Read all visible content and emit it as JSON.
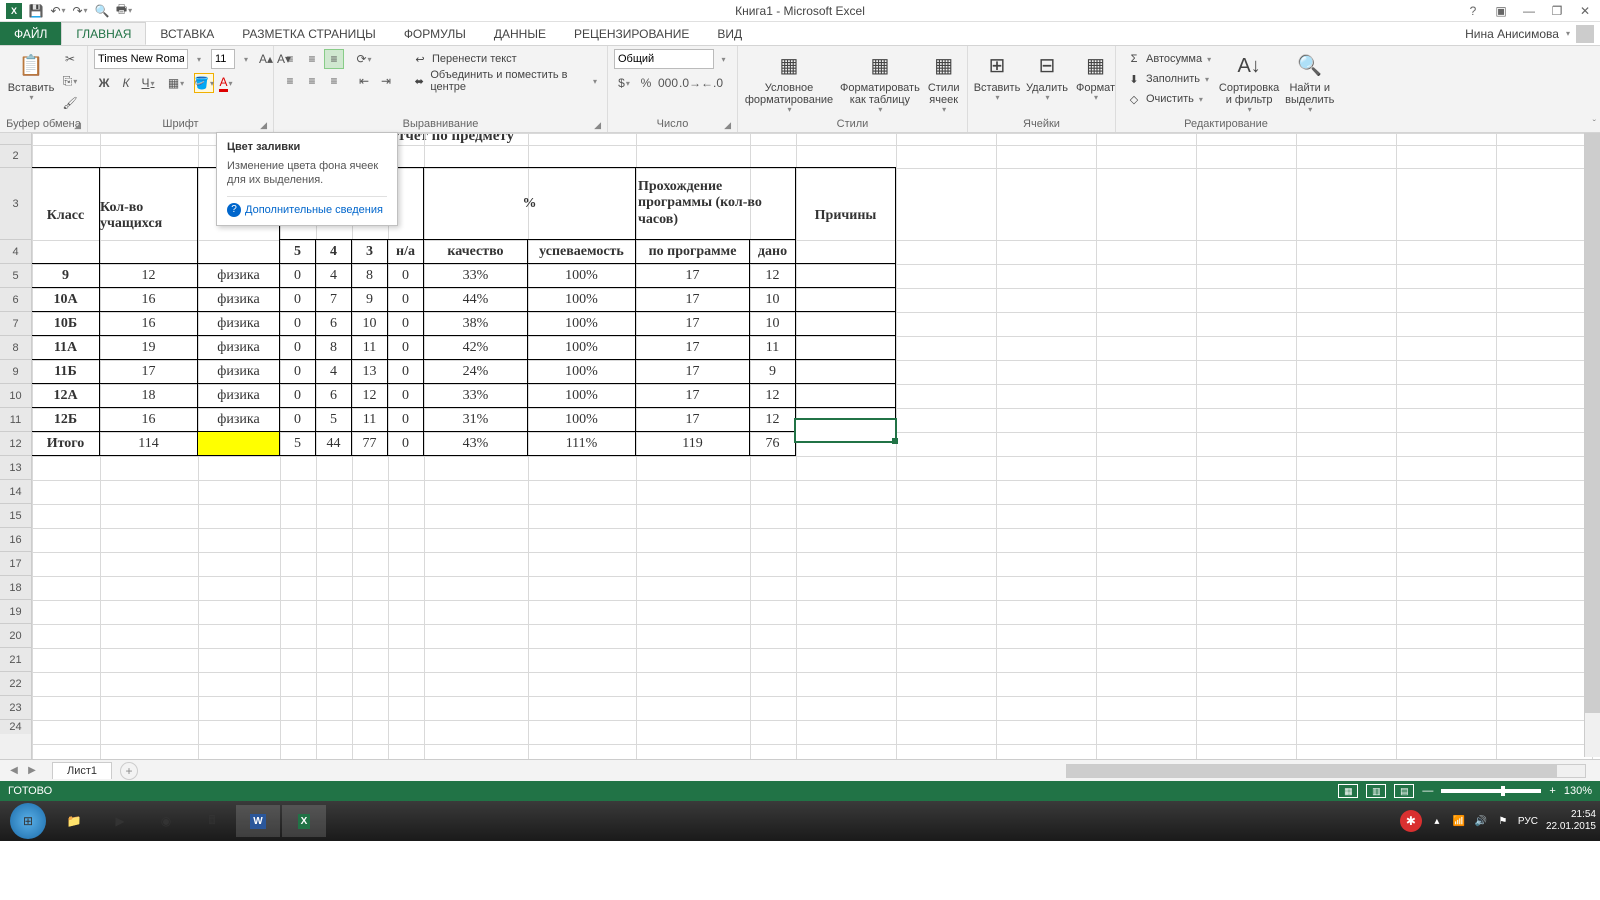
{
  "title": "Книга1 - Microsoft Excel",
  "user": "Нина Анисимова",
  "tabs": {
    "file": "ФАЙЛ",
    "home": "ГЛАВНАЯ",
    "insert": "ВСТАВКА",
    "layout": "РАЗМЕТКА СТРАНИЦЫ",
    "formulas": "ФОРМУЛЫ",
    "data": "ДАННЫЕ",
    "review": "РЕЦЕНЗИРОВАНИЕ",
    "view": "ВИД"
  },
  "ribbon": {
    "clipboard": {
      "paste": "Вставить",
      "label": "Буфер обмена"
    },
    "font": {
      "name": "Times New Roma",
      "size": "11",
      "bold": "Ж",
      "italic": "К",
      "underline": "Ч",
      "label": "Шрифт"
    },
    "align": {
      "wrap": "Перенести текст",
      "merge": "Объединить и поместить в центре",
      "label": "Выравнивание"
    },
    "number": {
      "format": "Общий",
      "label": "Число"
    },
    "styles": {
      "cond": "Условное форматирование",
      "table": "Форматировать как таблицу",
      "cell": "Стили ячеек",
      "label": "Стили"
    },
    "cells": {
      "insert": "Вставить",
      "delete": "Удалить",
      "format": "Формат",
      "label": "Ячейки"
    },
    "editing": {
      "sum": "Автосумма",
      "fill": "Заполнить",
      "clear": "Очистить",
      "sort": "Сортировка и фильтр",
      "find": "Найти и выделить",
      "label": "Редактирование"
    }
  },
  "tooltip": {
    "title": "Цвет заливки",
    "desc": "Изменение цвета фона ячеек для их выделения.",
    "link": "Дополнительные сведения"
  },
  "partial_header": "тчет по предмету",
  "table": {
    "hdr": {
      "class": "Класс",
      "students": "Кол-во учащихся",
      "pct": "%",
      "prog": "Прохождение программы (кол-во часов)",
      "reasons": "Причины",
      "g5": "5",
      "g4": "4",
      "g3": "3",
      "na": "н/а",
      "quality": "качество",
      "progress": "успеваемость",
      "byprog": "по программе",
      "given": "дано"
    },
    "rows": [
      {
        "class": "9",
        "n": "12",
        "subj": "физика",
        "g5": "0",
        "g4": "4",
        "g3": "8",
        "na": "0",
        "q": "33%",
        "p": "100%",
        "bp": "17",
        "gv": "12"
      },
      {
        "class": "10А",
        "n": "16",
        "subj": "физика",
        "g5": "0",
        "g4": "7",
        "g3": "9",
        "na": "0",
        "q": "44%",
        "p": "100%",
        "bp": "17",
        "gv": "10"
      },
      {
        "class": "10Б",
        "n": "16",
        "subj": "физика",
        "g5": "0",
        "g4": "6",
        "g3": "10",
        "na": "0",
        "q": "38%",
        "p": "100%",
        "bp": "17",
        "gv": "10"
      },
      {
        "class": "11А",
        "n": "19",
        "subj": "физика",
        "g5": "0",
        "g4": "8",
        "g3": "11",
        "na": "0",
        "q": "42%",
        "p": "100%",
        "bp": "17",
        "gv": "11"
      },
      {
        "class": "11Б",
        "n": "17",
        "subj": "физика",
        "g5": "0",
        "g4": "4",
        "g3": "13",
        "na": "0",
        "q": "24%",
        "p": "100%",
        "bp": "17",
        "gv": "9"
      },
      {
        "class": "12А",
        "n": "18",
        "subj": "физика",
        "g5": "0",
        "g4": "6",
        "g3": "12",
        "na": "0",
        "q": "33%",
        "p": "100%",
        "bp": "17",
        "gv": "12"
      },
      {
        "class": "12Б",
        "n": "16",
        "subj": "физика",
        "g5": "0",
        "g4": "5",
        "g3": "11",
        "na": "0",
        "q": "31%",
        "p": "100%",
        "bp": "17",
        "gv": "12"
      }
    ],
    "total": {
      "class": "Итого",
      "n": "114",
      "g5": "5",
      "g4": "44",
      "g3": "77",
      "na": "0",
      "q": "43%",
      "p": "111%",
      "bp": "119",
      "gv": "76"
    }
  },
  "sheet": {
    "name": "Лист1"
  },
  "status": {
    "ready": "ГОТОВО",
    "zoom": "130%"
  },
  "taskbar": {
    "lang": "РУС",
    "time": "21:54",
    "date": "22.01.2015"
  }
}
